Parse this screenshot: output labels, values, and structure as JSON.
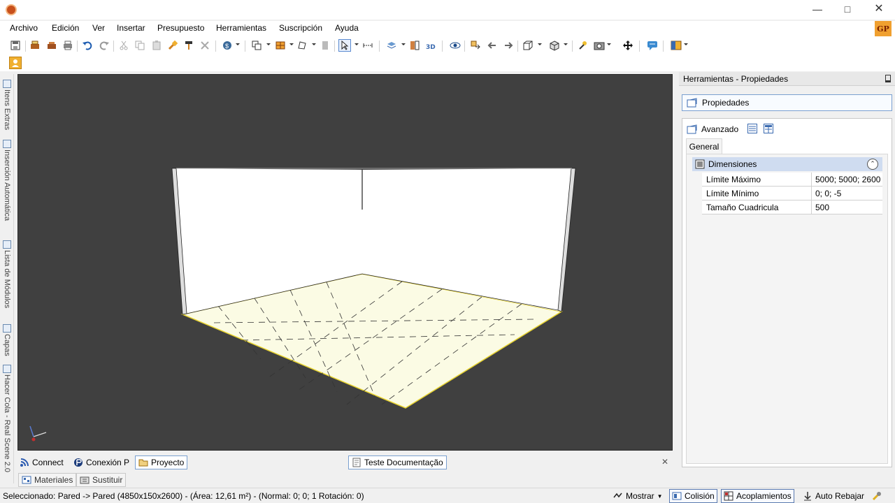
{
  "menu": [
    "Archivo",
    "Edición",
    "Ver",
    "Insertar",
    "Presupuesto",
    "Herramientas",
    "Suscripción",
    "Ayuda"
  ],
  "user_badge": "GP",
  "left_tabs": [
    "Itens Extras",
    "Inserción Automática",
    "Lista de Módulos",
    "Capas",
    "Hacer Cola - Real Scene 2.0"
  ],
  "bottom_tabs": {
    "connect": "Connect",
    "conexion": "Conexión P",
    "proyecto": "Proyecto",
    "teste": "Teste Documentação"
  },
  "lower_tabs": {
    "materiales": "Materiales",
    "sustituir": "Sustituir"
  },
  "status": {
    "text": "Seleccionado: Pared -> Pared (4850x150x2600) - (Área: 12,61 m²) - (Normal: 0; 0; 1 Rotación: 0)",
    "mostrar": "Mostrar",
    "colision": "Colisión",
    "acoplamientos": "Acoplamientos",
    "auto_rebajar": "Auto Rebajar"
  },
  "right_panel": {
    "title": "Herramientas - Propiedades",
    "header": "Propiedades",
    "avanzado": "Avanzado",
    "tab_general": "General",
    "category": "Dimensiones",
    "rows": [
      {
        "key": "Límite Máximo",
        "value": "5000; 5000; 2600"
      },
      {
        "key": "Límite Mínimo",
        "value": "0; 0; -5"
      },
      {
        "key": "Tamaño Cuadricula",
        "value": "500"
      }
    ]
  },
  "colors": {
    "viewport_bg": "#404040",
    "floor": "#fbfbe4",
    "wall": "#ffffff",
    "accent": "#7aa0d0"
  }
}
